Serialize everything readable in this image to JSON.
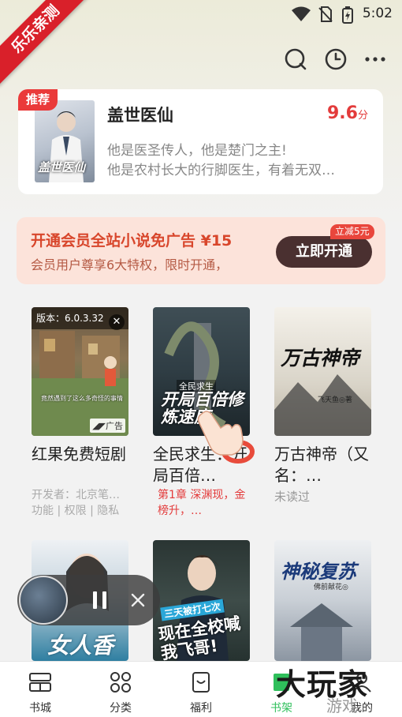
{
  "ribbon": {
    "label": "乐乐亲测"
  },
  "status_bar": {
    "time": "5:02"
  },
  "toolbar": {
    "icons": [
      "search-icon",
      "history-clock-icon",
      "more-icon"
    ]
  },
  "recommend": {
    "badge": "推荐",
    "title": "盖世医仙",
    "score": "9.6",
    "score_unit": "分",
    "desc_line1": "他是医圣传人，他是楚门之主!",
    "desc_line2": "他是农村长大的行脚医生，有着无双…",
    "cover_text": "盖世医仙"
  },
  "vip_banner": {
    "title": "开通会员全站小说免广告 ¥15",
    "subtitle": "会员用户尊享6大特权，限时开通，",
    "button": "立即开通",
    "tag": "立减5元"
  },
  "books": [
    {
      "title": "红果免费短剧",
      "ad_version": "版本：6.0.3.32",
      "ad_label": "广告",
      "ad_meta_line1": "开发者：北京笔…",
      "ad_meta_line2": "功能 | 权限 | 隐私",
      "cover_caption": "竟然遇到了这么多奇怪的事情"
    },
    {
      "title": "全民求生：开局百倍…",
      "progress": "第1章 深渊现，金榜升，…",
      "cover_text": "开局百倍修炼速度",
      "cover_small": "全民求生"
    },
    {
      "title": "万古神帝（又名：…",
      "status": "未读过",
      "cover_text": "万古神帝",
      "cover_author": "飞天鱼◎著"
    },
    {
      "title": "",
      "cover_text": "女人香"
    },
    {
      "title": "",
      "cover_text": "现在全校喊我飞哥!",
      "cover_small": "三天被打七次"
    },
    {
      "title": "",
      "cover_text": "神秘复苏",
      "cover_small": "佛前献花◎"
    }
  ],
  "player": {
    "pause_icon": "pause-icon",
    "close_icon": "close-icon"
  },
  "tabbar": {
    "tabs": [
      {
        "label": "书城",
        "icon": "bookstore-icon"
      },
      {
        "label": "分类",
        "icon": "category-icon"
      },
      {
        "label": "福利",
        "icon": "welfare-icon"
      },
      {
        "label": "书架",
        "icon": "bookshelf-icon",
        "active": true
      },
      {
        "label": "我的",
        "icon": "profile-icon"
      }
    ]
  },
  "watermark": {
    "text": "大玩家",
    "sub": "游戏"
  },
  "colors": {
    "accent_red": "#e33b3b",
    "active_green": "#2fbf5b",
    "vip_button": "#4a3030"
  }
}
